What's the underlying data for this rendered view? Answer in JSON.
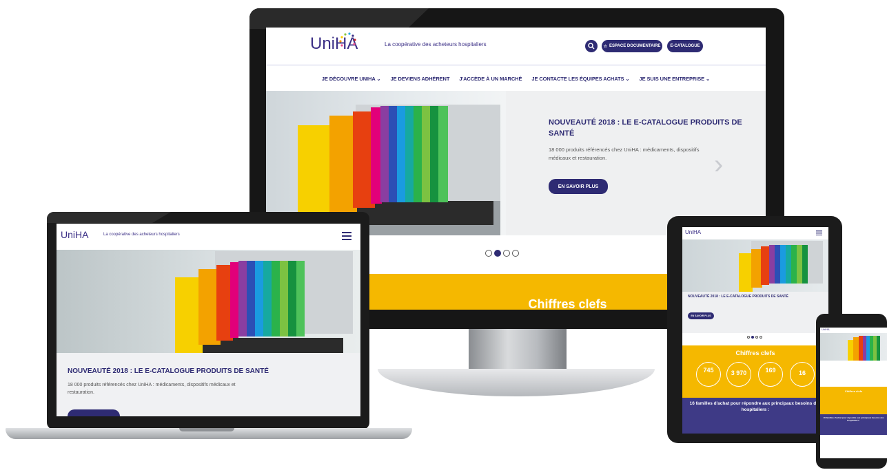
{
  "colors": {
    "brand_purple": "#2e2b73",
    "yellow": "#f5b800",
    "dark_purple": "#3e3a86",
    "bezel": "#161616"
  },
  "brand": {
    "logo_text": "UniHA",
    "tagline": "La coopérative des acheteurs hospitaliers"
  },
  "desktop": {
    "search_icon": "search-icon",
    "espace_label": "ESPACE DOCUMENTAIRE",
    "ecatalogue_label": "E-CATALOGUE",
    "nav": [
      "JE DÉCOUVRE UNIHA",
      "JE DEVIENS ADHÉRENT",
      "J'ACCÈDE À UN MARCHÉ",
      "JE CONTACTE LES ÉQUIPES ACHATS",
      "JE SUIS UNE ENTREPRISE"
    ],
    "hero_title": "NOUVEAUTÉ 2018 : LE E-CATALOGUE PRODUITS DE SANTÉ",
    "hero_desc": "18 000 produits référencés chez UniHA : médicaments, dispositifs médicaux et restauration.",
    "hero_button": "EN SAVOIR PLUS",
    "section_title": "Chiffres clefs"
  },
  "laptop": {
    "hero_title": "NOUVEAUTÉ 2018 : LE E-CATALOGUE PRODUITS DE SANTÉ",
    "hero_desc": "18 000 produits référencés chez UniHA : médicaments, dispositifs médicaux et restauration."
  },
  "tablet": {
    "hero_title": "NOUVEAUTÉ 2018 : LE E-CATALOGUE PRODUITS DE SANTÉ",
    "hero_button": "EN SAVOIR PLUS",
    "section_title": "Chiffres clefs",
    "stats": [
      "745",
      "3 970",
      "169",
      "16"
    ],
    "families_title": "16 familles d'achat pour répondre aux principaux besoins des hospitaliers :"
  },
  "phone": {
    "section_title": "Chiffres clefs",
    "families_title": "16 familles d'achat pour répondre aux principaux besoins des hospitaliers :"
  }
}
